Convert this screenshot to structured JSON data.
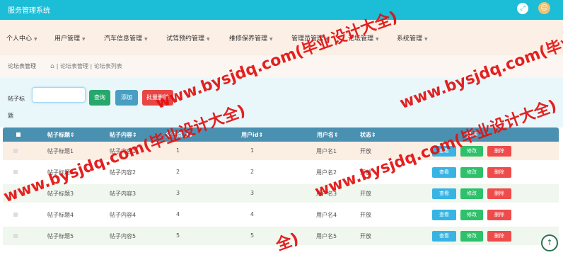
{
  "app": {
    "title": "服务管理系统",
    "expand_glyph": "⤢",
    "avatar_glyph": "☺"
  },
  "nav": {
    "items": [
      {
        "label": "个人中心"
      },
      {
        "label": "用户管理"
      },
      {
        "label": "汽车信息管理"
      },
      {
        "label": "试驾预约管理"
      },
      {
        "label": "维修保养管理"
      },
      {
        "label": "管理员管理"
      },
      {
        "label": "论坛管理"
      },
      {
        "label": "系统管理"
      }
    ],
    "caret": "▼"
  },
  "breadcrumb": {
    "current_title": "论坛表管理",
    "path": "| 论坛表管理 | 论坛表列表",
    "home_glyph": "⌂"
  },
  "search": {
    "label": "帖子标题",
    "input_value": "",
    "search_button": "查询",
    "add_button": "添加",
    "batch_delete_button": "批量删除"
  },
  "table": {
    "headers": [
      "帖子标题",
      "帖子内容",
      "父节点id",
      "用户id",
      "用户名",
      "状态",
      "操作"
    ],
    "sort_glyph": "⇕",
    "rows": [
      {
        "title": "帖子标题1",
        "content": "帖子内容1",
        "parentid": "1",
        "userid": "1",
        "username": "用户名1",
        "status": "开放"
      },
      {
        "title": "帖子标题2",
        "content": "帖子内容2",
        "parentid": "2",
        "userid": "2",
        "username": "用户名2",
        "status": "开放"
      },
      {
        "title": "帖子标题3",
        "content": "帖子内容3",
        "parentid": "3",
        "userid": "3",
        "username": "用户名3",
        "status": "开放"
      },
      {
        "title": "帖子标题4",
        "content": "帖子内容4",
        "parentid": "4",
        "userid": "4",
        "username": "用户名4",
        "status": "开放"
      },
      {
        "title": "帖子标题5",
        "content": "帖子内容5",
        "parentid": "5",
        "userid": "5",
        "username": "用户名5",
        "status": "开放"
      }
    ],
    "actions": {
      "view": "查看",
      "edit": "修改",
      "delete": "删除"
    }
  },
  "watermark": {
    "text": "www.bysjdq.com(毕业设计大全)",
    "text_short": "www.bysjdq.com(毕业设计一",
    "text_tail": "全)"
  },
  "scroll_top_glyph": "↑",
  "colors": {
    "topbar": "#1cbdd6",
    "nav_bg": "#fbefe6",
    "header_bg": "#4a90b0",
    "watermark": "#e20f0f"
  }
}
